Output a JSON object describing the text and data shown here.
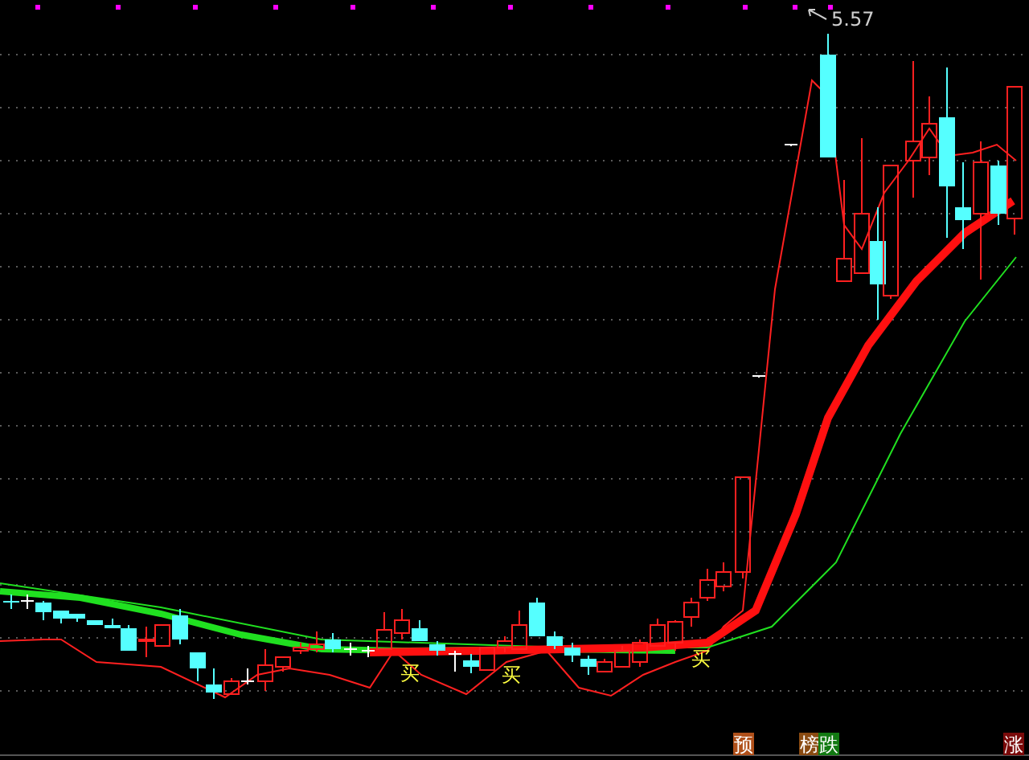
{
  "chart": {
    "high_label": "5.57",
    "buy_marks": [
      {
        "label": "买"
      },
      {
        "label": "买"
      },
      {
        "label": "买"
      }
    ],
    "badges": [
      {
        "label": "预",
        "color": "#b0501a"
      },
      {
        "label": "榜",
        "color": "#8a4b12"
      },
      {
        "label": "跌",
        "color": "#127a12"
      },
      {
        "label": "涨",
        "color": "#7a0a0a"
      }
    ]
  }
}
